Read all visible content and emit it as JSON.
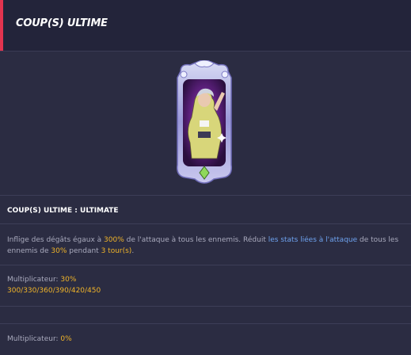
{
  "header": {
    "title": "COUP(S) ULTIME"
  },
  "skill": {
    "name": "COUP(S) ULTIME : ULTIMATE"
  },
  "description": {
    "part1": "Inflige des dégâts égaux à ",
    "pct": "300%",
    "part2": " de l'attaque à tous les ennemis. Réduit ",
    "link": "les stats liées à l'attaque",
    "part3": " de tous les ennemis de ",
    "reduce": "30%",
    "part4": " pendant ",
    "turns": "3 tour(s)",
    "part5": "."
  },
  "multiplier1": {
    "label": "Multiplicateur: ",
    "value": "30%",
    "levels": "300/330/360/390/420/450"
  },
  "multiplier2": {
    "label": "Multiplicateur: ",
    "value": "0%"
  },
  "colors": {
    "accent": "#e3344f",
    "highlight": "#f0b429",
    "link": "#6ea3f0",
    "bg": "#2b2c42",
    "header_bg": "#23243a"
  }
}
